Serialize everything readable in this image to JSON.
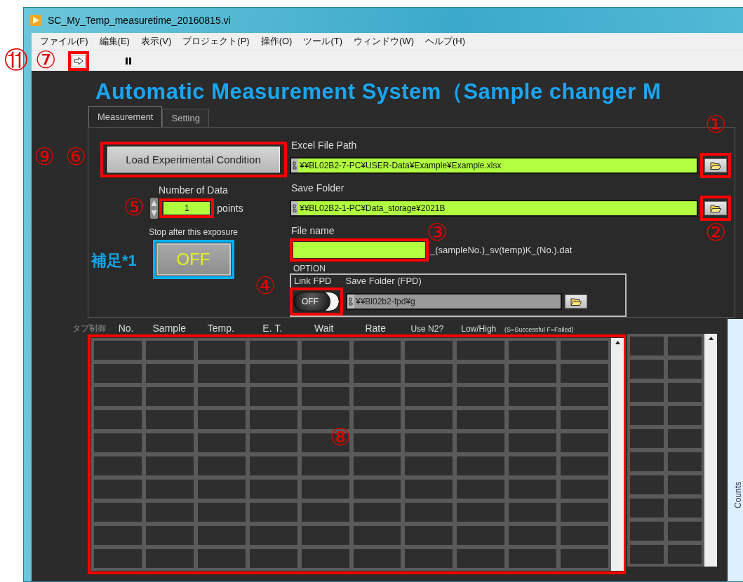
{
  "window": {
    "title": "SC_My_Temp_measuretime_20160815.vi"
  },
  "menu": [
    {
      "label": "ファイル(F)"
    },
    {
      "label": "編集(E)"
    },
    {
      "label": "表示(V)"
    },
    {
      "label": "プロジェクト(P)"
    },
    {
      "label": "操作(O)"
    },
    {
      "label": "ツール(T)"
    },
    {
      "label": "ウィンドウ(W)"
    },
    {
      "label": "ヘルプ(H)"
    }
  ],
  "toolbar": {
    "run_highlight": {
      "color": "#ff0000"
    }
  },
  "panel": {
    "heading": "Automatic Measurement System（Sample changer M",
    "tabs": [
      {
        "label": "Measurement",
        "selected": true
      },
      {
        "label": "Setting",
        "selected": false
      }
    ],
    "load_button": {
      "label": "Load Experimental Condition",
      "highlight": {
        "color": "#ff0000"
      }
    },
    "number_of_data": {
      "label": "Number of Data",
      "value": "1",
      "unit": "points",
      "highlight": {
        "color": "#ff0000"
      }
    },
    "stop_after": {
      "label": "Stop after this exposure",
      "button": "OFF",
      "on": false,
      "highlight": {
        "color": "#00b0f0"
      }
    },
    "excel_file_path": {
      "label": "Excel File Path",
      "value": "¥¥BL02B2-7-PC¥USER-Data¥Example¥Example.xlsx",
      "browse_highlight": {
        "color": "#ff0000"
      }
    },
    "save_folder": {
      "label": "Save Folder",
      "value": "¥¥BL02B2-1-PC¥Data_storage¥2021B",
      "browse_highlight": {
        "color": "#ff0000"
      }
    },
    "file_name": {
      "label": "File name",
      "suffix": "_(sampleNo.)_sv(temp)K_(No.).dat",
      "highlight": {
        "color": "#ff0000"
      }
    },
    "option": {
      "label": "OPTION",
      "link_fpd": {
        "label": "Link FPD",
        "switch": "OFF",
        "on": false,
        "highlight": {
          "color": "#ff0000"
        }
      },
      "fpd_folder": {
        "label": "Save Folder (FPD)",
        "value": "¥¥Bl02b2-fpd¥g"
      }
    }
  },
  "table": {
    "caption": "タブ制御",
    "columns": [
      "No.",
      "Sample",
      "Temp.",
      "E. T.",
      "Wait",
      "Rate",
      "Use N2?",
      "Low/High",
      "(S=Successful F=Failed)"
    ],
    "highlight": {
      "color": "#ff0000"
    }
  },
  "graph": {
    "ylabel": "Counts"
  },
  "annotations": [
    {
      "label": "⑪"
    },
    {
      "label": "⑦"
    },
    {
      "label": "⑨"
    },
    {
      "label": "⑥"
    },
    {
      "label": "①"
    },
    {
      "label": "⑤"
    },
    {
      "label": "②"
    },
    {
      "label": "③"
    },
    {
      "label": "④"
    },
    {
      "label": "⑧"
    }
  ],
  "note": {
    "label": "補足*1"
  }
}
